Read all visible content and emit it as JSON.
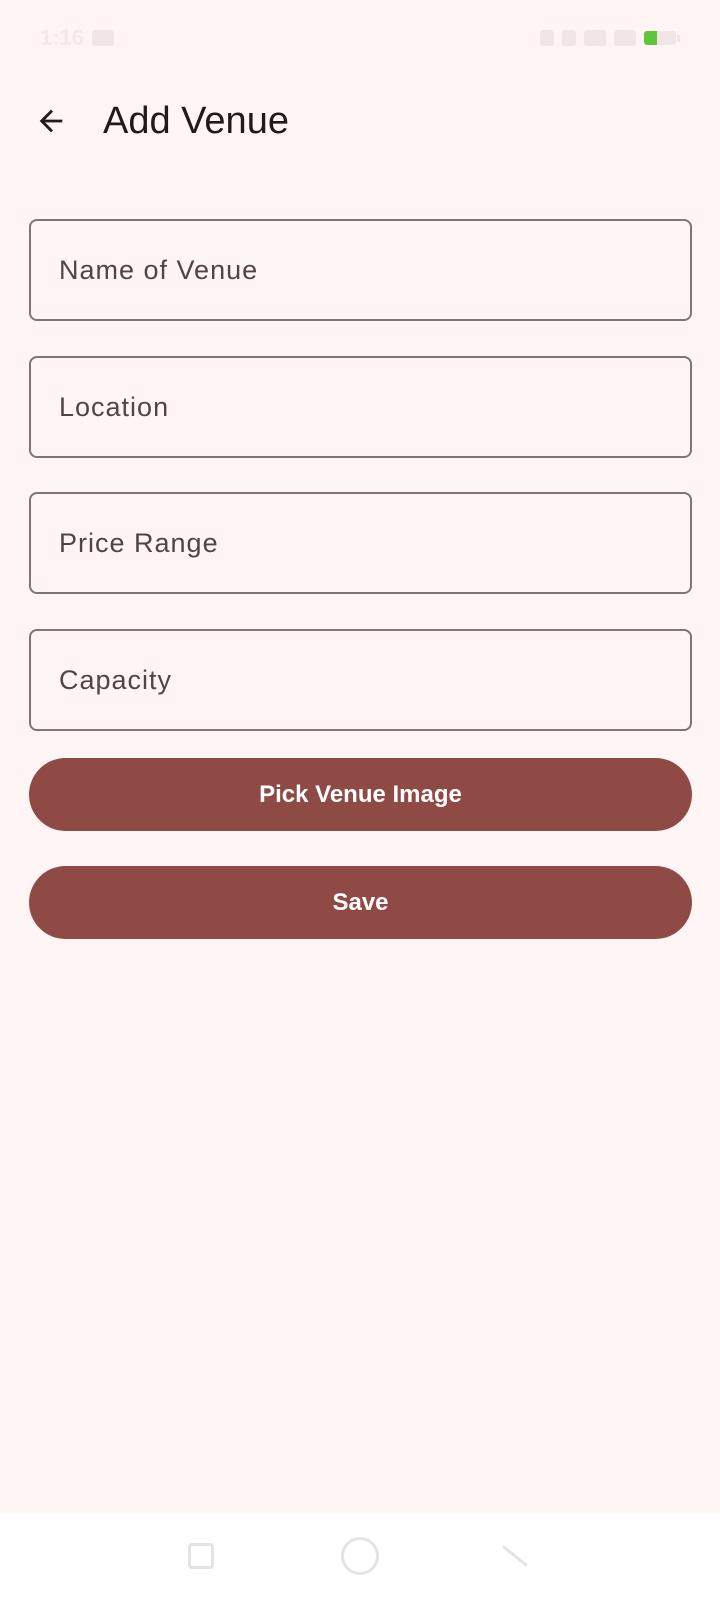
{
  "status_bar": {
    "time": "1:16",
    "battery_level_percent": 40,
    "battery_color": "#5ec53d"
  },
  "app_bar": {
    "back_icon": "arrow-left-icon",
    "title": "Add Venue"
  },
  "form": {
    "fields": [
      {
        "placeholder": "Name of Venue",
        "value": ""
      },
      {
        "placeholder": "Location",
        "value": ""
      },
      {
        "placeholder": "Price Range",
        "value": ""
      },
      {
        "placeholder": "Capacity",
        "value": ""
      }
    ]
  },
  "actions": {
    "pick_image_label": "Pick Venue Image",
    "save_label": "Save"
  },
  "theme": {
    "background": "#fff5f4",
    "primary": "#904a45",
    "outline": "#857371"
  },
  "nav_bar": {
    "recent_icon": "recent-apps-icon",
    "home_icon": "home-icon",
    "back_icon": "nav-back-icon"
  }
}
